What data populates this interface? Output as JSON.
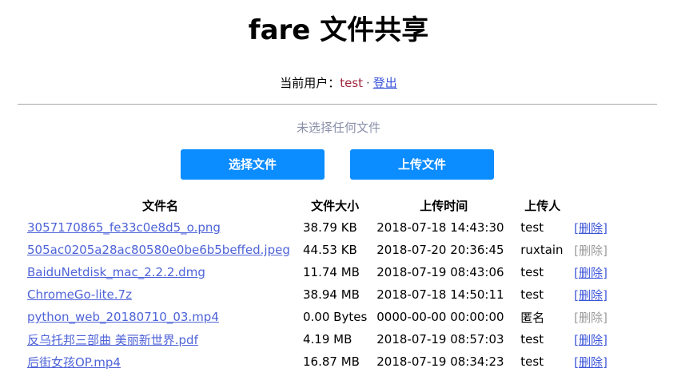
{
  "header": {
    "title": "fare 文件共享"
  },
  "userbar": {
    "label": "当前用户：",
    "username": "test",
    "separator": "·",
    "logout_label": "登出"
  },
  "upload": {
    "status_text": "未选择任何文件",
    "select_label": "选择文件",
    "upload_label": "上传文件"
  },
  "table": {
    "columns": [
      "文件名",
      "文件大小",
      "上传时间",
      "上传人",
      ""
    ],
    "delete_label": "[删除]",
    "rows": [
      {
        "name": "3057170865_fe33c0e8d5_o.png",
        "size": "38.79 KB",
        "time": "2018-07-18 14:43:30",
        "user": "test",
        "can_delete": true
      },
      {
        "name": "505ac0205a28ac80580e0be6b5beffed.jpeg",
        "size": "44.53 KB",
        "time": "2018-07-20 20:36:45",
        "user": "ruxtain",
        "can_delete": false
      },
      {
        "name": "BaiduNetdisk_mac_2.2.2.dmg",
        "size": "11.74 MB",
        "time": "2018-07-19 08:43:06",
        "user": "test",
        "can_delete": true
      },
      {
        "name": "ChromeGo-lite.7z",
        "size": "38.94 MB",
        "time": "2018-07-18 14:50:11",
        "user": "test",
        "can_delete": true
      },
      {
        "name": "python_web_20180710_03.mp4",
        "size": "0.00 Bytes",
        "time": "0000-00-00 00:00:00",
        "user": "匿名",
        "can_delete": false
      },
      {
        "name": "反乌托邦三部曲 美丽新世界.pdf",
        "size": "4.19 MB",
        "time": "2018-07-19 08:57:03",
        "user": "test",
        "can_delete": true
      },
      {
        "name": "后街女孩OP.mp4",
        "size": "16.87 MB",
        "time": "2018-07-19 08:34:23",
        "user": "test",
        "can_delete": true
      }
    ]
  }
}
